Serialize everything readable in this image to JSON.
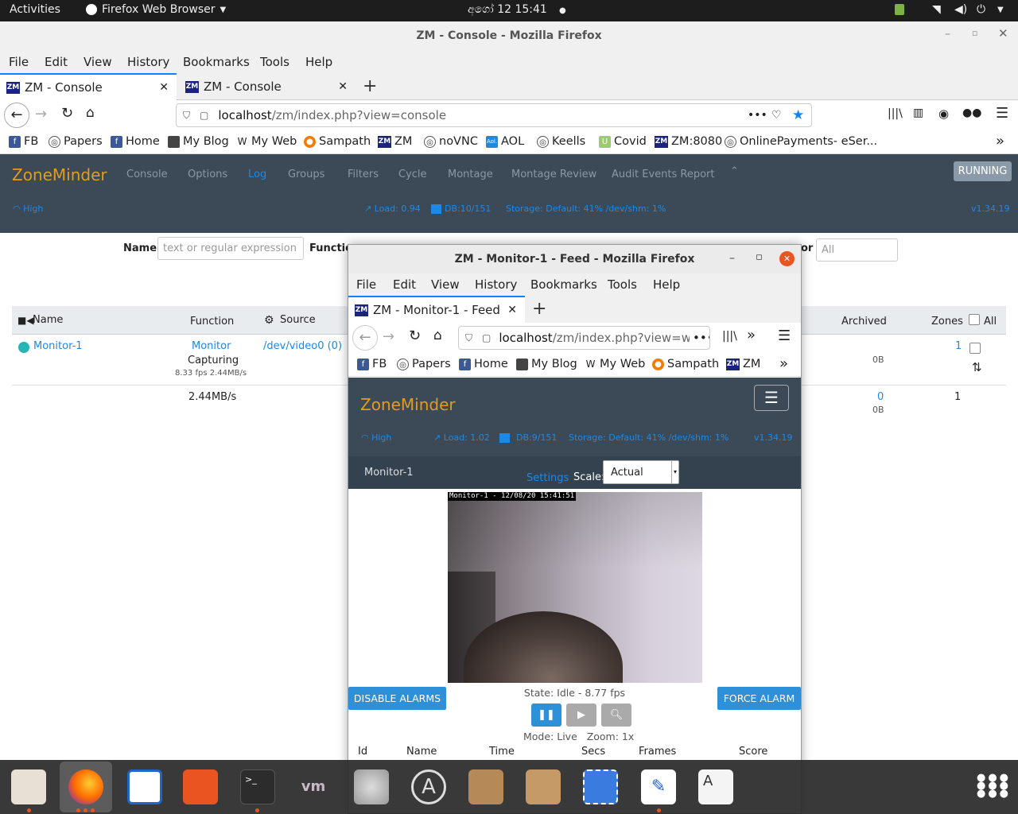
{
  "topbar": {
    "activities": "Activities",
    "app": "Firefox Web Browser",
    "clock": "අගෝ 12  15:41"
  },
  "main_window": {
    "title": "ZM - Console - Mozilla Firefox",
    "menu": [
      "File",
      "Edit",
      "View",
      "History",
      "Bookmarks",
      "Tools",
      "Help"
    ],
    "tabs": [
      {
        "label": "ZM - Console",
        "active": true
      },
      {
        "label": "ZM - Console",
        "active": false
      }
    ],
    "url_host": "localhost",
    "url_path": "/zm/index.php?view=console",
    "bookmarks": [
      "FB",
      "Papers",
      "Home",
      "My Blog",
      "My Web",
      "Sampath",
      "ZM",
      "noVNC",
      "AOL",
      "Keells",
      "Covid",
      "ZM:8080",
      "OnlinePayments- eSer..."
    ]
  },
  "zm": {
    "brand": "ZoneMinder",
    "nav": [
      "Console",
      "Options",
      "Log",
      "Groups",
      "Filters",
      "Cycle",
      "Montage",
      "Montage Review",
      "Audit Events Report"
    ],
    "status": "RUNNING",
    "bandwidth": "High",
    "load": "Load: 0.94",
    "db": "DB:10/151",
    "storage": "Storage: Default: 41% /dev/shm: 1%",
    "version": "v1.34.19",
    "filter": {
      "name_label": "Name",
      "name_placeholder": "text or regular expression",
      "function_label": "Functio",
      "monitor_label": "or",
      "monitor_value": "All"
    },
    "table": {
      "headers": {
        "name": "Name",
        "function": "Function",
        "source": "Source",
        "archived": "Archived",
        "zones": "Zones",
        "all": "All"
      },
      "row": {
        "name": "Monitor-1",
        "function": "Monitor",
        "state": "Capturing",
        "fps": "8.33 fps 2.44MB/s",
        "source": "/dev/video0 (0)",
        "archived": "0B",
        "zones": "1"
      },
      "totals": {
        "bandwidth": "2.44MB/s",
        "archived_count": "0",
        "archived_size": "0B",
        "zones": "1"
      }
    }
  },
  "popup": {
    "title": "ZM - Monitor-1 - Feed - Mozilla Firefox",
    "menu": [
      "File",
      "Edit",
      "View",
      "History",
      "Bookmarks",
      "Tools",
      "Help"
    ],
    "tab": "ZM - Monitor-1 - Feed",
    "url_host": "localhost",
    "url_path": "/zm/index.php?view=w",
    "bookmarks": [
      "FB",
      "Papers",
      "Home",
      "My Blog",
      "My Web",
      "Sampath",
      "ZM"
    ],
    "brand": "ZoneMinder",
    "bandwidth": "High",
    "load": "Load: 1.02",
    "db": "DB:9/151",
    "storage": "Storage: Default: 41% /dev/shm: 1%",
    "version": "v1.34.19",
    "monitor": "Monitor-1",
    "settings": "Settings",
    "scale_label": "Scale:",
    "scale_value": "Actual",
    "overlay": "Monitor-1 - 12/08/20 15:41:51",
    "disable_alarms": "DISABLE ALARMS",
    "force_alarm": "FORCE ALARM",
    "state": "State: Idle - 8.77 fps",
    "mode": "Mode: Live",
    "zoom": "Zoom: 1x",
    "events_headers": [
      "Id",
      "Name",
      "Time",
      "Secs",
      "Frames",
      "Score"
    ]
  },
  "colors": {
    "accent": "#e69a1a",
    "link": "#1e88e5",
    "header": "#3c4a58",
    "button": "#2e90d8"
  }
}
